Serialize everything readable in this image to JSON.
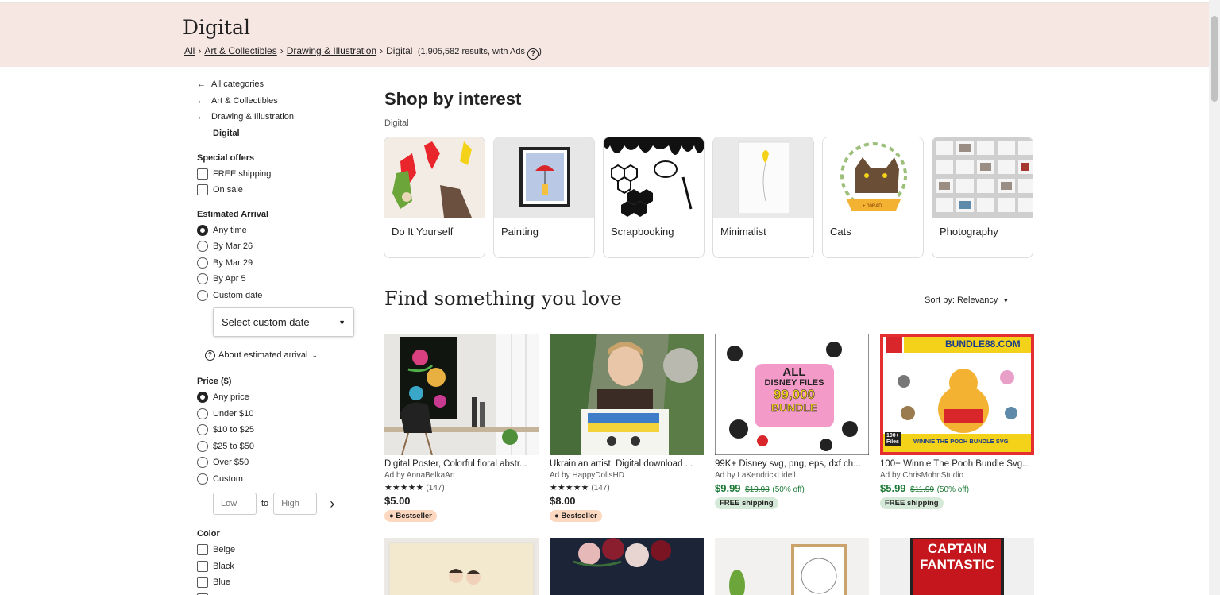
{
  "header": {
    "title": "Digital",
    "breadcrumb": [
      "All",
      "Art & Collectibles",
      "Drawing & Illustration"
    ],
    "current": "Digital",
    "results": "(1,905,582 results, with Ads",
    "results_close": ")",
    "help_glyph": "?"
  },
  "sidebar": {
    "back_links": [
      "All categories",
      "Art & Collectibles",
      "Drawing & Illustration"
    ],
    "current_category": "Digital",
    "special_offers": {
      "title": "Special offers",
      "options": [
        "FREE shipping",
        "On sale"
      ]
    },
    "arrival": {
      "title": "Estimated Arrival",
      "options": [
        "Any time",
        "By Mar 26",
        "By Mar 29",
        "By Apr 5",
        "Custom date"
      ],
      "selected": 0,
      "select_label": "Select custom date",
      "about": "About estimated arrival"
    },
    "price": {
      "title": "Price ($)",
      "options": [
        "Any price",
        "Under $10",
        "$10 to $25",
        "$25 to $50",
        "Over $50",
        "Custom"
      ],
      "selected": 0,
      "low_placeholder": "Low",
      "high_placeholder": "High",
      "to": "to"
    },
    "color": {
      "title": "Color",
      "options": [
        "Beige",
        "Black",
        "Blue"
      ]
    }
  },
  "interests": {
    "title": "Shop by interest",
    "subtitle": "Digital",
    "cards": [
      {
        "label": "Do It Yourself"
      },
      {
        "label": "Painting"
      },
      {
        "label": "Scrapbooking"
      },
      {
        "label": "Minimalist"
      },
      {
        "label": "Cats"
      },
      {
        "label": "Photography"
      }
    ],
    "cat_banner_text": "+ 00RAD"
  },
  "find": {
    "title": "Find something you love",
    "sort_label": "Sort by: Relevancy"
  },
  "listings": [
    {
      "title": "Digital Poster, Colorful floral abstr...",
      "ad": "Ad by AnnaBelkaArt",
      "stars": "★★★★★",
      "reviews": "(147)",
      "price": "$5.00",
      "badge": "Bestseller"
    },
    {
      "title": "Ukrainian artist. Digital download ...",
      "ad": "Ad by HappyDollsHD",
      "stars": "★★★★★",
      "reviews": "(147)",
      "price": "$8.00",
      "badge": "Bestseller"
    },
    {
      "title": "99K+ Disney svg, png, eps, dxf ch...",
      "ad": "Ad by LaKendrickLidell",
      "price": "$9.99",
      "orig": "$19.98",
      "off": "(50% off)",
      "badge": "FREE shipping",
      "img_text": [
        "ALL",
        "DISNEY FILES",
        "99,000",
        "BUNDLE"
      ]
    },
    {
      "title": "100+ Winnie The Pooh Bundle Svg...",
      "ad": "Ad by ChrisMohnStudio",
      "price": "$5.99",
      "orig": "$11.99",
      "off": "(50% off)",
      "badge": "FREE shipping",
      "img_text": [
        "BUNDLE88.COM",
        "WINNIE THE POOH BUNDLE SVG",
        "100+",
        "Files"
      ]
    }
  ],
  "row2": {
    "captain_text": [
      "CAPTAIN",
      "FANTASTIC"
    ]
  },
  "colors": {
    "banner_bg": "#f7e7e3",
    "sale_green": "#1d7a37",
    "bestseller_bg": "#fdd8c0",
    "shipping_bg": "#d4e9d7"
  }
}
